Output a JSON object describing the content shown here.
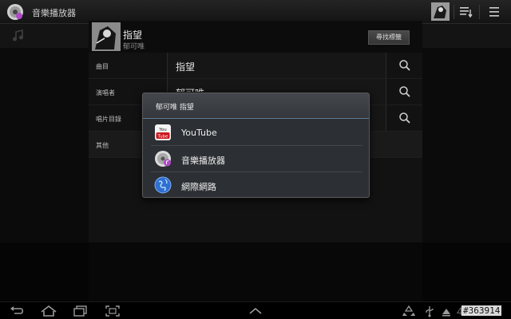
{
  "app": {
    "title": "音樂播放器",
    "icon": "cd-disc-icon"
  },
  "song": {
    "title": "指望",
    "artist": "郁可唯",
    "find_tags_label": "尋找標籤"
  },
  "rows": [
    {
      "label": "曲目",
      "value": "指望"
    },
    {
      "label": "演唱者",
      "value": "郁可唯"
    },
    {
      "label": "唱片目錄",
      "value": ""
    },
    {
      "label": "其他",
      "value": ""
    }
  ],
  "dialog": {
    "title": "郁可唯 指望",
    "items": [
      {
        "label": "YouTube",
        "icon": "youtube-icon"
      },
      {
        "label": "音樂播放器",
        "icon": "cd-disc-icon"
      },
      {
        "label": "網際網路",
        "icon": "globe-icon"
      }
    ]
  },
  "status": {
    "time": "4:06",
    "watermark": "#363914"
  },
  "colors": {
    "dialog_bg": "#2c2f33",
    "dialog_title_bg": "#3c3f43",
    "youtube_red": "#cc181e",
    "globe_blue": "#2f6fd0"
  }
}
